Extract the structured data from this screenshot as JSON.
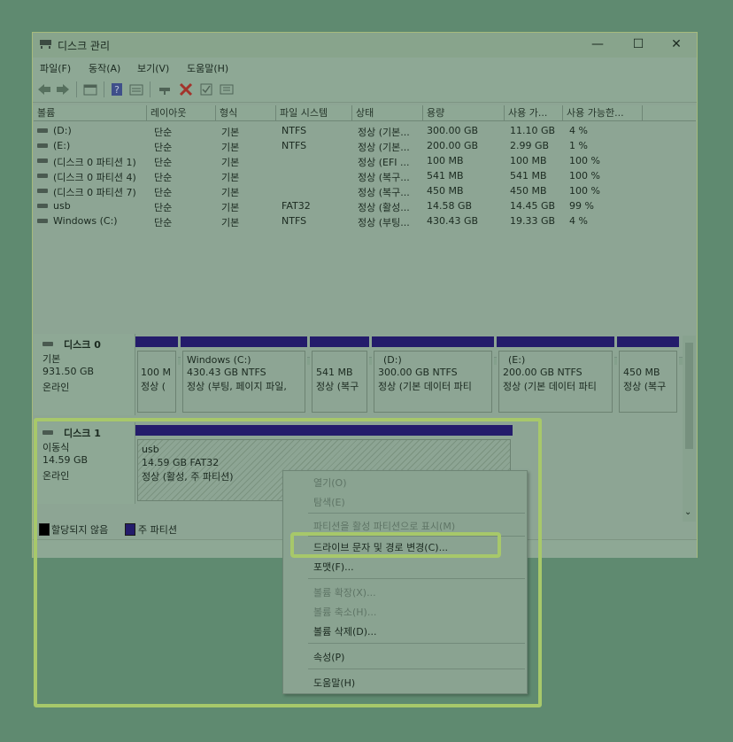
{
  "window": {
    "title": "디스크 관리",
    "minimize": "—",
    "maximize": "☐",
    "close": "✕"
  },
  "menu": [
    "파일(F)",
    "동작(A)",
    "보기(V)",
    "도움말(H)"
  ],
  "toolbar_icons": [
    "back-arrow-icon",
    "forward-arrow-icon",
    "console-tree-icon",
    "help-icon",
    "properties-icon",
    "connect-icon",
    "delete-icon",
    "check-icon",
    "list-icon"
  ],
  "columns": [
    "볼륨",
    "레이아웃",
    "형식",
    "파일 시스템",
    "상태",
    "용량",
    "사용 가...",
    "사용 가능한..."
  ],
  "volumes": [
    [
      "(D:)",
      "단순",
      "기본",
      "NTFS",
      "정상 (기본...",
      "300.00 GB",
      "11.10 GB",
      "4 %"
    ],
    [
      "(E:)",
      "단순",
      "기본",
      "NTFS",
      "정상 (기본...",
      "200.00 GB",
      "2.99 GB",
      "1 %"
    ],
    [
      "(디스크 0 파티션 1)",
      "단순",
      "기본",
      "",
      "정상 (EFI ...",
      "100 MB",
      "100 MB",
      "100 %"
    ],
    [
      "(디스크 0 파티션 4)",
      "단순",
      "기본",
      "",
      "정상 (복구...",
      "541 MB",
      "541 MB",
      "100 %"
    ],
    [
      "(디스크 0 파티션 7)",
      "단순",
      "기본",
      "",
      "정상 (복구...",
      "450 MB",
      "450 MB",
      "100 %"
    ],
    [
      "usb",
      "단순",
      "기본",
      "FAT32",
      "정상 (활성...",
      "14.58 GB",
      "14.45 GB",
      "99 %"
    ],
    [
      "Windows (C:)",
      "단순",
      "기본",
      "NTFS",
      "정상 (부팅...",
      "430.43 GB",
      "19.33 GB",
      "4 %"
    ]
  ],
  "disk0": {
    "name": "디스크 0",
    "type": "기본",
    "size": "931.50 GB",
    "status": "온라인",
    "partitions": [
      {
        "l1": "",
        "l2": "100 M",
        "l3": "정상 ("
      },
      {
        "l1": "Windows  (C:)",
        "l2": "430.43 GB NTFS",
        "l3": "정상 (부팅, 페이지 파일,"
      },
      {
        "l1": "",
        "l2": "541 MB",
        "l3": "정상 (복구"
      },
      {
        "l1": "(D:)",
        "l2": "300.00 GB NTFS",
        "l3": "정상 (기본 데이터 파티"
      },
      {
        "l1": "(E:)",
        "l2": "200.00 GB NTFS",
        "l3": "정상 (기본 데이터 파티"
      },
      {
        "l1": "",
        "l2": "450 MB",
        "l3": "정상 (복구"
      }
    ]
  },
  "disk1": {
    "name": "디스크 1",
    "type": "이동식",
    "size": "14.59 GB",
    "status": "온라인",
    "partition": {
      "l1": "usb",
      "l2": "14.59 GB FAT32",
      "l3": "정상 (활성, 주 파티션)"
    }
  },
  "legend": {
    "unallocated": "할당되지 않음",
    "primary": "주 파티션"
  },
  "context_menu": {
    "open": "열기(O)",
    "explore": "탐색(E)",
    "mark_active": "파티션을 활성 파티션으로 표시(M)",
    "change_letter": "드라이브 문자 및 경로 변경(C)...",
    "format": "포맷(F)...",
    "extend": "볼륨 확장(X)...",
    "shrink": "볼륨 축소(H)...",
    "delete": "볼륨 삭제(D)...",
    "properties": "속성(P)",
    "help": "도움말(H)"
  },
  "colors": {
    "primary_partition": "#241c6b",
    "unallocated": "#000000",
    "highlight": "#a7c86a"
  }
}
